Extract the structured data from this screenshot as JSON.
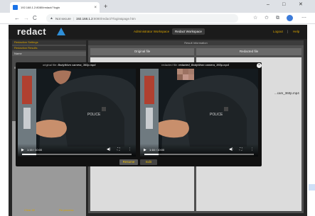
{
  "browser": {
    "tab_title": "192.168.1.2:8080/redact/?login",
    "tab_close": "×",
    "new_tab": "+",
    "window_controls": [
      "–",
      "□",
      "✕"
    ],
    "back": "←",
    "forward": "→",
    "reload": "C",
    "security_warning": "Not secure",
    "url_host": "192.168.1.2",
    "url_path": ":8080/redact/?login&page.htm",
    "icons": [
      "star-icon",
      "extensions-icon",
      "collections-icon",
      "profile-icon",
      "menu-icon"
    ]
  },
  "app": {
    "logo": "redact",
    "workspaces": [
      "Administrator Workspace",
      "Redact Workspace"
    ],
    "active_workspace": "Redact Workspace",
    "logout": "Logout",
    "separator": "|",
    "help": "Help"
  },
  "sidebar": {
    "settings": "Redaction Settings",
    "results": "Redaction Results",
    "name_header": "Name",
    "file_entry": "Bod",
    "clear_all": "Clear All",
    "reprocess": "Re-process"
  },
  "main": {
    "panel_title": "Result Information",
    "original_col": "Original file",
    "redacted_col": "Redacted file",
    "redacted_filename": "...cam_360p.mp4"
  },
  "modal": {
    "original_label": "original file:",
    "original_name": "BodyWorn camera_360p.mp4",
    "redacted_label": "redacted file:",
    "redacted_name": "redacted_BodyWorn camera_360p.mp4",
    "close": "×",
    "left_video": {
      "time": "1:16 / 10:00",
      "progress": 0.13
    },
    "right_video": {
      "time": "1:16 / 10:00",
      "progress": 0.13
    },
    "resume_label": "Resume",
    "edit_label": "Edit"
  },
  "colors": {
    "accent": "#d9a400",
    "brand_blue": "#2f8fd8",
    "app_bg": "#262626"
  }
}
